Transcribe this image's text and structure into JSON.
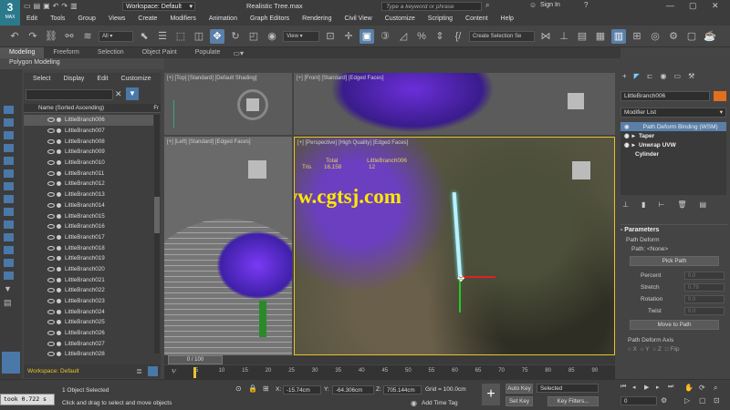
{
  "titlebar": {
    "app_logo": "3",
    "app_logo_sub": "MAX",
    "workspace": "Workspace: Default",
    "file_title": "Realistic Tree.max",
    "search_placeholder": "Type a keyword or phrase",
    "sign_in": "Sign In"
  },
  "menu": [
    "Edit",
    "Tools",
    "Group",
    "Views",
    "Create",
    "Modifiers",
    "Animation",
    "Graph Editors",
    "Rendering",
    "Civil View",
    "Customize",
    "Scripting",
    "Content",
    "Help"
  ],
  "toolbar": {
    "filter_dropdown": "All",
    "refcoord_dropdown": "View",
    "selection_set": "Create Selection Se"
  },
  "ribbon": {
    "tabs": [
      "Modeling",
      "Freeform",
      "Selection",
      "Object Paint",
      "Populate"
    ],
    "sub_tab": "Polygon Modeling"
  },
  "scene_explorer": {
    "menu": [
      "Select",
      "Display",
      "Edit",
      "Customize"
    ],
    "column_header": "Name (Sorted Ascending)",
    "column_header2": "Fr",
    "items": [
      "LittleBranch006",
      "LittleBranch007",
      "LittleBranch008",
      "LittleBranch009",
      "LittleBranch010",
      "LittleBranch011",
      "LittleBranch012",
      "LittleBranch013",
      "LittleBranch014",
      "LittleBranch015",
      "LittleBranch016",
      "LittleBranch017",
      "LittleBranch018",
      "LittleBranch019",
      "LittleBranch020",
      "LittleBranch021",
      "LittleBranch022",
      "LittleBranch023",
      "LittleBranch024",
      "LittleBranch025",
      "LittleBranch026",
      "LittleBranch027",
      "LittleBranch028"
    ],
    "workspace": "Workspace: Default"
  },
  "viewports": {
    "top": "[+] [Top] [Standard] [Default Shading]",
    "front": "[+] [Front] [Standard] [Edged Faces]",
    "left": "[+] [Left] [Standard] [Edged Faces]",
    "perspective": "[+] [Perspective] [High Quality] [Edged Faces]",
    "stats_total": "Total",
    "stats_object": "LittleBranch006",
    "stats_tris_label": "Tris",
    "stats_value": "16,158",
    "stats_value2": "12",
    "watermark": "www.cgtsj.com"
  },
  "command_panel": {
    "object_name": "LittleBranch006",
    "modifier_list": "Modifier List",
    "stack": [
      {
        "label": "Path Deform Binding (WSM)",
        "selected": true
      },
      {
        "label": "Taper",
        "selected": false
      },
      {
        "label": "Unwrap UVW",
        "selected": false
      },
      {
        "label": "Cylinder",
        "selected": false
      }
    ],
    "rollout_title": "Parameters",
    "path_deform_label": "Path Deform",
    "path_label": "Path: <None>",
    "pick_path": "Pick Path",
    "percent_label": "Percent",
    "percent_value": "0.0",
    "stretch_label": "Stretch",
    "stretch_value": "0.79",
    "rotation_label": "Rotation",
    "rotation_value": "0.0",
    "twist_label": "Twist",
    "twist_value": "0.0",
    "move_to_path": "Move to Path",
    "axis_title": "Path Deform Axis",
    "axis_x": "X",
    "axis_y": "Y",
    "axis_z": "Z",
    "flip": "Flip"
  },
  "timeline": {
    "frame_range": "0 / 100",
    "ticks": [
      "5",
      "10",
      "15",
      "20",
      "25",
      "30",
      "35",
      "40",
      "45",
      "50",
      "55",
      "60",
      "65",
      "70",
      "75",
      "80",
      "85",
      "90"
    ]
  },
  "status": {
    "timer": "took 0.722 s",
    "selected": "1 Object Selected",
    "prompt": "Click and drag to select and move objects",
    "x_label": "X:",
    "x_value": "-15.74cm",
    "y_label": "Y:",
    "y_value": "-64.306cm",
    "z_label": "Z:",
    "z_value": "705.144cm",
    "grid": "Grid = 100.0cm",
    "add_time_tag": "Add Time Tag",
    "auto_key": "Auto Key",
    "set_key": "Set Key",
    "selected_dropdown": "Selected",
    "key_filters": "Key Filters...",
    "frame": "0"
  }
}
